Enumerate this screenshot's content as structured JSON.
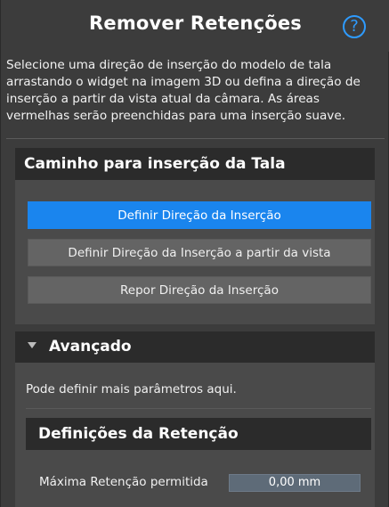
{
  "header": {
    "title": "Remover Retenções",
    "help_icon": "?"
  },
  "description": "Selecione uma direção de inserção do modelo de tala arrastando o widget na imagem 3D ou defina a direção de inserção a partir da vista atual da câmara. As áreas vermelhas serão preenchidas para uma inserção suave.",
  "insertion_path": {
    "heading": "Caminho para inserção da Tala",
    "buttons": {
      "set_direction": "Definir Direção da Inserção",
      "set_direction_from_view": "Definir Direção da Inserção a partir da vista",
      "reset_direction": "Repor Direção da Inserção"
    }
  },
  "advanced": {
    "heading": "Avançado",
    "info": "Pode definir mais parâmetros aqui.",
    "undercut_settings": {
      "heading": "Definições da Retenção",
      "max_undercut_label": "Máxima Retenção permitida",
      "max_undercut_value": "0,00 mm"
    }
  },
  "colors": {
    "accent": "#1a85ee",
    "help_icon": "#2e9bff",
    "panel_bg": "#3c3c3c",
    "section_header_bg": "#2b2b2b",
    "section_body_bg": "#4a4a4a"
  }
}
